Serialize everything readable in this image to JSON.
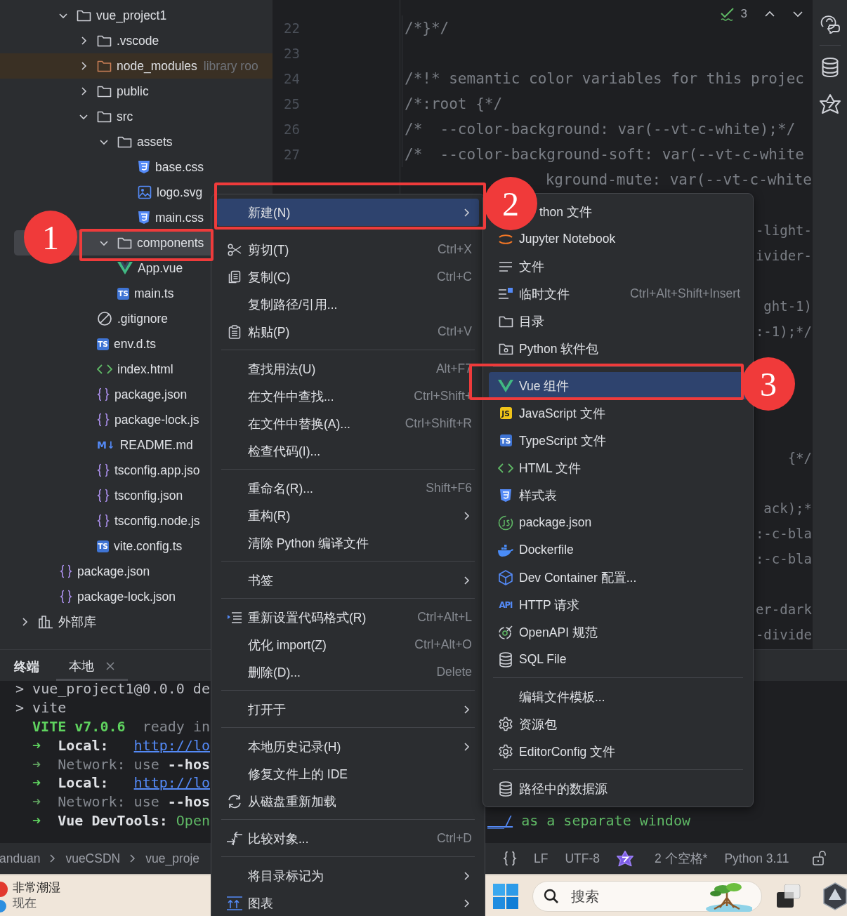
{
  "project_tree": [
    {
      "label": "vue_project1",
      "kind": "folder",
      "expanded": true,
      "selected": false,
      "children": [
        {
          "label": ".vscode",
          "kind": "folder",
          "expanded": false,
          "selected": false
        },
        {
          "label": "node_modules",
          "kind": "library-folder",
          "expanded": false,
          "selected": false,
          "hint": "library roo"
        },
        {
          "label": "public",
          "kind": "folder",
          "expanded": false,
          "selected": false
        },
        {
          "label": "src",
          "kind": "folder",
          "expanded": true,
          "selected": false,
          "children": [
            {
              "label": "assets",
              "kind": "folder",
              "expanded": true,
              "selected": false,
              "children": [
                {
                  "label": "base.css",
                  "kind": "css",
                  "selected": false
                },
                {
                  "label": "logo.svg",
                  "kind": "image",
                  "selected": false
                },
                {
                  "label": "main.css",
                  "kind": "css",
                  "selected": false
                }
              ]
            },
            {
              "label": "components",
              "kind": "folder",
              "expanded": true,
              "selected": true
            },
            {
              "label": "App.vue",
              "kind": "vue",
              "selected": false
            },
            {
              "label": "main.ts",
              "kind": "ts",
              "badge": "TS",
              "selected": false
            }
          ]
        },
        {
          "label": ".gitignore",
          "kind": "ignore",
          "selected": false
        },
        {
          "label": "env.d.ts",
          "kind": "ts",
          "badge": "TS",
          "selected": false
        },
        {
          "label": "index.html",
          "kind": "html",
          "selected": false
        },
        {
          "label": "package.json",
          "kind": "json",
          "selected": false
        },
        {
          "label": "package-lock.js",
          "kind": "json",
          "selected": false
        },
        {
          "label": "README.md",
          "kind": "markdown",
          "badge": "M↓",
          "selected": false
        },
        {
          "label": "tsconfig.app.jso",
          "kind": "json",
          "selected": false
        },
        {
          "label": "tsconfig.json",
          "kind": "json",
          "selected": false
        },
        {
          "label": "tsconfig.node.js",
          "kind": "json",
          "selected": false
        },
        {
          "label": "vite.config.ts",
          "kind": "ts",
          "badge": "TS",
          "selected": false
        }
      ]
    }
  ],
  "root_files": [
    {
      "label": "package.json",
      "kind": "json",
      "selected": false
    },
    {
      "label": "package-lock.json",
      "kind": "json",
      "selected": false
    }
  ],
  "external_libraries": {
    "label": "外部库",
    "expanded": false,
    "selected": false
  },
  "editor": {
    "inspection_count": "3",
    "lines": [
      {
        "number": "22",
        "code": [
          "/*}*/"
        ]
      },
      {
        "number": "23"
      },
      {
        "number": "24",
        "code": [
          "/*!* semantic color variables for this projec"
        ]
      },
      {
        "number": "25",
        "code": [
          "/*:root {*/"
        ]
      },
      {
        "number": "26",
        "code": [
          "/*  --color-background: var(--vt-c-white);*/"
        ]
      },
      {
        "number": "27",
        "code": [
          "/*  --color-background-soft: var(--vt-c-white"
        ]
      }
    ],
    "hidden_line_ends": [
      "kground-mute: var(--vt-c-white",
      "-light-",
      "ivider-",
      "ght-1)",
      ":-1);*/",
      "{*/",
      "ack);*",
      ":-c-bla",
      ":-c-bla",
      "er-dark",
      "-divide"
    ]
  },
  "context_menu": {
    "items": [
      {
        "kind": "plain",
        "label": "新建(N)",
        "submenu": true,
        "selected": true
      },
      {
        "kind": "cut",
        "label": "剪切(T)",
        "shortcut": "Ctrl+X",
        "submenu": false,
        "selected": false
      },
      {
        "kind": "copy",
        "label": "复制(C)",
        "shortcut": "Ctrl+C",
        "submenu": false,
        "selected": false
      },
      {
        "kind": "plain",
        "label": "复制路径/引用...",
        "submenu": false,
        "selected": false
      },
      {
        "kind": "paste",
        "label": "粘贴(P)",
        "shortcut": "Ctrl+V",
        "submenu": false,
        "selected": false
      },
      {
        "kind": "separator"
      },
      {
        "kind": "plain",
        "label": "查找用法(U)",
        "shortcut": "Alt+F7",
        "submenu": false,
        "selected": false
      },
      {
        "kind": "plain",
        "label": "在文件中查找...",
        "shortcut": "Ctrl+Shift+",
        "submenu": false,
        "selected": false
      },
      {
        "kind": "plain",
        "label": "在文件中替换(A)...",
        "shortcut": "Ctrl+Shift+R",
        "submenu": false,
        "selected": false
      },
      {
        "kind": "plain",
        "label": "检查代码(I)...",
        "submenu": false,
        "selected": false
      },
      {
        "kind": "separator"
      },
      {
        "kind": "plain",
        "label": "重命名(R)...",
        "shortcut": "Shift+F6",
        "submenu": false,
        "selected": false
      },
      {
        "kind": "plain",
        "label": "重构(R)",
        "submenu": true,
        "selected": false
      },
      {
        "kind": "plain",
        "label": "清除 Python 编译文件",
        "submenu": false,
        "selected": false
      },
      {
        "kind": "separator"
      },
      {
        "kind": "plain",
        "label": "书签",
        "submenu": true,
        "selected": false
      },
      {
        "kind": "separator"
      },
      {
        "kind": "reformat",
        "label": "重新设置代码格式(R)",
        "shortcut": "Ctrl+Alt+L",
        "submenu": false,
        "selected": false
      },
      {
        "kind": "plain",
        "label": "优化 import(Z)",
        "shortcut": "Ctrl+Alt+O",
        "submenu": false,
        "selected": false
      },
      {
        "kind": "plain",
        "label": "删除(D)...",
        "shortcut": "Delete",
        "submenu": false,
        "selected": false
      },
      {
        "kind": "separator"
      },
      {
        "kind": "plain",
        "label": "打开于",
        "submenu": true,
        "selected": false
      },
      {
        "kind": "separator"
      },
      {
        "kind": "plain",
        "label": "本地历史记录(H)",
        "submenu": true,
        "selected": false
      },
      {
        "kind": "plain",
        "label": "修复文件上的 IDE",
        "submenu": false,
        "selected": false
      },
      {
        "kind": "reload",
        "label": "从磁盘重新加载",
        "submenu": false,
        "selected": false
      },
      {
        "kind": "separator"
      },
      {
        "kind": "compare",
        "label": "比较对象...",
        "shortcut": "Ctrl+D",
        "submenu": false,
        "selected": false
      },
      {
        "kind": "separator"
      },
      {
        "kind": "plain",
        "label": "将目录标记为",
        "submenu": true,
        "selected": false
      },
      {
        "kind": "diagram",
        "label": "图表",
        "submenu": true,
        "selected": false
      }
    ]
  },
  "new_submenu": {
    "items": [
      {
        "kind": "covered",
        "label": "thon 文件",
        "submenu": false,
        "selected": false
      },
      {
        "kind": "jupyter",
        "label": "Jupyter Notebook",
        "submenu": false,
        "selected": false
      },
      {
        "kind": "text-file",
        "label": "文件",
        "submenu": false,
        "selected": false
      },
      {
        "kind": "scratch",
        "label": "临时文件",
        "shortcut": "Ctrl+Alt+Shift+Insert",
        "submenu": false,
        "selected": false
      },
      {
        "kind": "directory",
        "label": "目录",
        "submenu": false,
        "selected": false
      },
      {
        "kind": "package",
        "label": "Python 软件包",
        "submenu": false,
        "selected": false
      },
      {
        "kind": "separator"
      },
      {
        "kind": "vue",
        "label": "Vue 组件",
        "submenu": false,
        "selected": true
      },
      {
        "kind": "js",
        "label": "JavaScript 文件",
        "badge": "JS",
        "submenu": false,
        "selected": false
      },
      {
        "kind": "ts",
        "label": "TypeScript 文件",
        "badge": "TS",
        "submenu": false,
        "selected": false
      },
      {
        "kind": "html",
        "label": "HTML 文件",
        "submenu": false,
        "selected": false
      },
      {
        "kind": "css",
        "label": "样式表",
        "submenu": false,
        "selected": false
      },
      {
        "kind": "npm",
        "label": "package.json",
        "submenu": false,
        "selected": false
      },
      {
        "kind": "docker",
        "label": "Dockerfile",
        "submenu": false,
        "selected": false
      },
      {
        "kind": "container",
        "label": "Dev Container 配置...",
        "submenu": false,
        "selected": false
      },
      {
        "kind": "http",
        "label": "HTTP 请求",
        "badge": "API",
        "submenu": false,
        "selected": false
      },
      {
        "kind": "openapi",
        "label": "OpenAPI 规范",
        "submenu": false,
        "selected": false
      },
      {
        "kind": "sql",
        "label": "SQL File",
        "submenu": false,
        "selected": false
      },
      {
        "kind": "separator"
      },
      {
        "kind": "plain",
        "label": "编辑文件模板...",
        "submenu": false,
        "selected": false
      },
      {
        "kind": "settings",
        "label": "资源包",
        "submenu": false,
        "selected": false
      },
      {
        "kind": "settings",
        "label": "EditorConfig 文件",
        "submenu": false,
        "selected": false
      },
      {
        "kind": "separator"
      },
      {
        "kind": "sql",
        "label": "路径中的数据源",
        "submenu": false,
        "selected": false
      }
    ]
  },
  "annotations": [
    {
      "number": "1"
    },
    {
      "number": "2"
    },
    {
      "number": "3"
    }
  ],
  "terminal": {
    "title": "终端",
    "tabs": [
      {
        "label": "本地",
        "selected": true
      }
    ],
    "lines": [
      {
        "segments": [
          {
            "kind": "prompt",
            "text": ">"
          },
          {
            "kind": "text",
            "text": " vue_project1@0.0.0 de"
          }
        ]
      },
      {
        "segments": [
          {
            "kind": "prompt",
            "text": ">"
          },
          {
            "kind": "text",
            "text": " vite"
          }
        ]
      },
      {
        "segments": [
          {
            "kind": "vite",
            "text": "  VITE v7.0.6"
          },
          {
            "kind": "dim",
            "text": "  ready in"
          }
        ]
      },
      {
        "segments": [
          {
            "kind": "arrow",
            "text": "  ➜  "
          },
          {
            "kind": "label",
            "text": "Local:   "
          },
          {
            "kind": "link",
            "text": "http://lo"
          }
        ]
      },
      {
        "segments": [
          {
            "kind": "arrow-dim",
            "text": "  ➜  "
          },
          {
            "kind": "dim",
            "text": "Network: use "
          },
          {
            "kind": "label",
            "text": "--hos"
          }
        ]
      },
      {
        "segments": [
          {
            "kind": "arrow",
            "text": "  ➜  "
          },
          {
            "kind": "label",
            "text": "Local:   "
          },
          {
            "kind": "link",
            "text": "http://lo"
          }
        ]
      },
      {
        "segments": [
          {
            "kind": "arrow-dim",
            "text": "  ➜  "
          },
          {
            "kind": "dim",
            "text": "Network: use "
          },
          {
            "kind": "label",
            "text": "--hos"
          }
        ]
      },
      {
        "segments": [
          {
            "kind": "arrow",
            "text": "  ➜  "
          },
          {
            "kind": "label",
            "text": "Vue DevTools:"
          },
          {
            "kind": "green",
            "text": " Open"
          }
        ],
        "tail": [
          {
            "kind": "link",
            "text": "__/"
          },
          {
            "kind": "green",
            "text": " as a separate window"
          }
        ]
      }
    ]
  },
  "status_bar": {
    "breadcrumb": [
      "anduan",
      "vueCSDN",
      "vue_proje"
    ],
    "line_separator": "LF",
    "encoding": "UTF-8",
    "indent": "2 个空格*",
    "interpreter": "Python 3.11"
  },
  "taskbar": {
    "weather": {
      "condition": "非常潮湿",
      "time": "现在"
    },
    "search": {
      "placeholder": "搜索"
    }
  }
}
